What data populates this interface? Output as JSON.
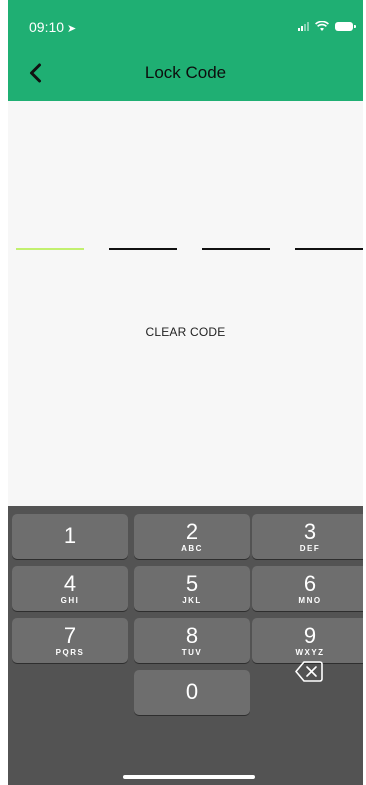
{
  "status_bar": {
    "time": "09:10"
  },
  "header": {
    "title": "Lock Code"
  },
  "code": {
    "slots": 4,
    "active_slot": 1
  },
  "clear_label": "CLEAR CODE",
  "keypad": {
    "keys": [
      {
        "num": "1",
        "letters": ""
      },
      {
        "num": "2",
        "letters": "ABC"
      },
      {
        "num": "3",
        "letters": "DEF"
      },
      {
        "num": "4",
        "letters": "GHI"
      },
      {
        "num": "5",
        "letters": "JKL"
      },
      {
        "num": "6",
        "letters": "MNO"
      },
      {
        "num": "7",
        "letters": "PQRS"
      },
      {
        "num": "8",
        "letters": "TUV"
      },
      {
        "num": "9",
        "letters": "WXYZ"
      },
      {
        "num": "0",
        "letters": ""
      }
    ]
  },
  "colors": {
    "header_bg": "#1faf73",
    "active_line": "#c2f06f",
    "keyboard_bg": "#535353",
    "key_bg": "#6e6e6e"
  }
}
